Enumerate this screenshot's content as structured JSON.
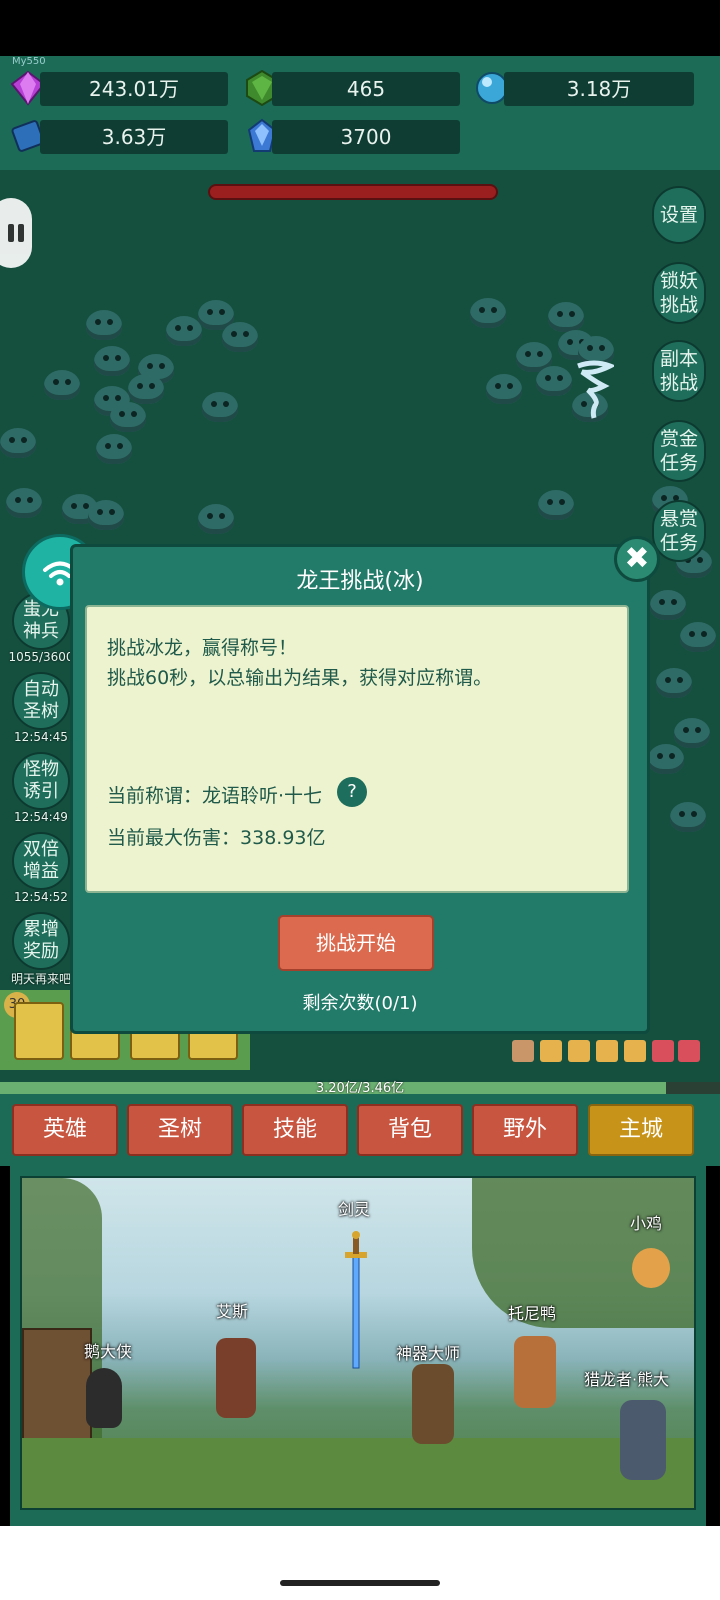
{
  "resources": {
    "gem": "243.01万",
    "green_crystal": "465",
    "orb": "3.18万",
    "book": "3.63万",
    "blue_crystal": "3700",
    "tiny_label": "My550"
  },
  "side_menu": [
    {
      "label": "设置"
    },
    {
      "label": "锁妖\n挑战"
    },
    {
      "label": "副本\n挑战"
    },
    {
      "label": "赏金\n任务"
    },
    {
      "label": "悬赏\n任务"
    }
  ],
  "left_menu": [
    {
      "label": "蚩尤\n神兵",
      "sub": "1055/3600"
    },
    {
      "label": "自动\n圣树",
      "sub": "12:54:45"
    },
    {
      "label": "怪物\n诱引",
      "sub": "12:54:49"
    },
    {
      "label": "双倍\n增益",
      "sub": "12:54:52"
    },
    {
      "label": "累增\n奖励",
      "sub": "明天再来吧"
    }
  ],
  "modal": {
    "title": "龙王挑战(冰)",
    "line1": "挑战冰龙，赢得称号！",
    "line2": "挑战60秒，以总输出为结果，获得对应称谓。",
    "current_title_label": "当前称谓：",
    "current_title_value": "龙语聆听·十七",
    "help": "?",
    "max_damage_label": "当前最大伤害：",
    "max_damage_value": "338.93亿",
    "start_button": "挑战开始",
    "remaining": "剩余次数(0/1)",
    "close": "✖"
  },
  "skill_slot_level": "30",
  "progress": {
    "text": "3.20亿/3.46亿",
    "fraction": 0.925
  },
  "tabs": [
    {
      "label": "英雄",
      "active": false
    },
    {
      "label": "圣树",
      "active": false
    },
    {
      "label": "技能",
      "active": false
    },
    {
      "label": "背包",
      "active": false
    },
    {
      "label": "野外",
      "active": false
    },
    {
      "label": "主城",
      "active": true
    }
  ],
  "scene_npcs": [
    {
      "label": "剑灵"
    },
    {
      "label": "小鸡"
    },
    {
      "label": "艾斯"
    },
    {
      "label": "托尼鸭"
    },
    {
      "label": "鹅大侠"
    },
    {
      "label": "神器大师"
    },
    {
      "label": "猎龙者·熊大"
    }
  ],
  "colors": {
    "accent": "#227a69",
    "tab": "#c85540",
    "tab_active": "#c89319",
    "start": "#dc6a4e"
  }
}
